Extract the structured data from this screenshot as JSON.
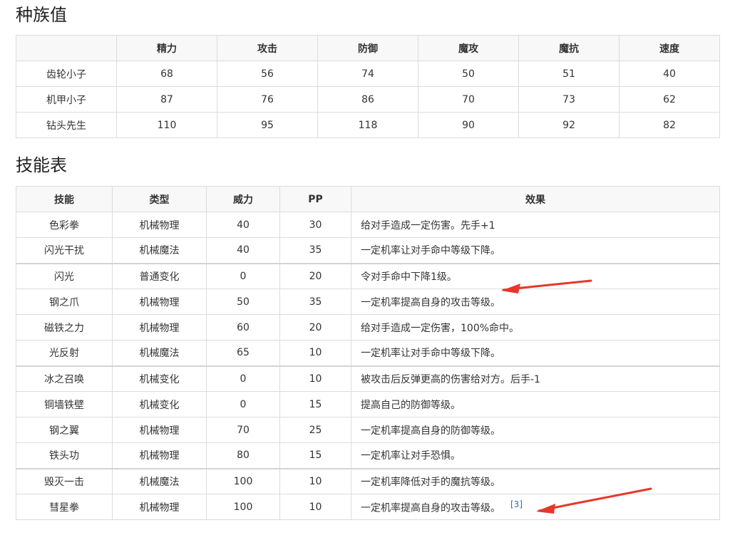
{
  "stats": {
    "heading": "种族值",
    "headers": [
      "",
      "精力",
      "攻击",
      "防御",
      "魔攻",
      "魔抗",
      "速度"
    ],
    "rows": [
      [
        "齿轮小子",
        "68",
        "56",
        "74",
        "50",
        "51",
        "40"
      ],
      [
        "机甲小子",
        "87",
        "76",
        "86",
        "70",
        "73",
        "62"
      ],
      [
        "钻头先生",
        "110",
        "95",
        "118",
        "90",
        "92",
        "82"
      ]
    ]
  },
  "skills": {
    "heading": "技能表",
    "headers": [
      "技能",
      "类型",
      "威力",
      "PP",
      "效果"
    ],
    "rows": [
      [
        "色彩拳",
        "机械物理",
        "40",
        "30",
        "给对手造成一定伤害。先手+1"
      ],
      [
        "闪光干扰",
        "机械魔法",
        "40",
        "35",
        "一定机率让对手命中等级下降。"
      ],
      [
        "闪光",
        "普通变化",
        "0",
        "20",
        "令对手命中下降1级。"
      ],
      [
        "钢之爪",
        "机械物理",
        "50",
        "35",
        "一定机率提高自身的攻击等级。"
      ],
      [
        "磁铁之力",
        "机械物理",
        "60",
        "20",
        "给对手造成一定伤害，100%命中。"
      ],
      [
        "光反射",
        "机械魔法",
        "65",
        "10",
        "一定机率让对手命中等级下降。"
      ],
      [
        "冰之召唤",
        "机械变化",
        "0",
        "10",
        "被攻击后反弹更高的伤害给对方。后手-1"
      ],
      [
        "铜墙铁壁",
        "机械变化",
        "0",
        "15",
        "提高自己的防御等级。"
      ],
      [
        "钢之翼",
        "机械物理",
        "70",
        "25",
        "一定机率提高自身的防御等级。"
      ],
      [
        "铁头功",
        "机械物理",
        "80",
        "15",
        "一定机率让对手恐惧。"
      ],
      [
        "毁灭一击",
        "机械魔法",
        "100",
        "10",
        "一定机率降低对手的魔抗等级。"
      ],
      [
        "彗星拳",
        "机械物理",
        "100",
        "10",
        "一定机率提高自身的攻击等级。"
      ]
    ],
    "citation": "[3]"
  },
  "colors": {
    "arrow": "#e8362a",
    "link": "#3366cc",
    "header_bg": "#f8f8f8",
    "border": "#dcdcdc"
  },
  "icons": [
    "red-annotation-arrow"
  ]
}
